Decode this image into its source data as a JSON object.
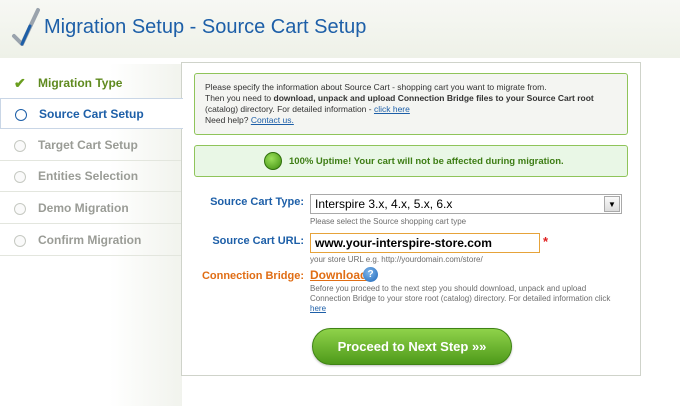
{
  "header": {
    "title": "Migration Setup - Source Cart Setup"
  },
  "sidebar": {
    "steps": [
      {
        "label": "Migration Type",
        "state": "done"
      },
      {
        "label": "Source Cart Setup",
        "state": "active"
      },
      {
        "label": "Target Cart Setup",
        "state": "pending"
      },
      {
        "label": "Entities Selection",
        "state": "pending"
      },
      {
        "label": "Demo Migration",
        "state": "pending"
      },
      {
        "label": "Confirm Migration",
        "state": "pending"
      }
    ]
  },
  "info": {
    "line1": "Please specify the information about Source Cart - shopping cart you want to migrate from.",
    "line2_prefix": "Then you need to ",
    "line2_bold": "download, unpack and upload Connection Bridge files to your Source Cart root",
    "line3": "(catalog) directory. For detailed information - ",
    "line3_link": "click here",
    "line4": "Need help? ",
    "line4_link": "Contact us."
  },
  "uptime": {
    "text": "100% Uptime! Your cart will not be affected during migration."
  },
  "form": {
    "source_type_label": "Source Cart Type:",
    "source_type_value": "Interspire 3.x, 4.x, 5.x, 6.x",
    "source_type_hint": "Please select the Source shopping cart type",
    "source_url_label": "Source Cart URL:",
    "source_url_value": "www.your-interspire-store.com",
    "source_url_hint": "your store URL e.g. http://yourdomain.com/store/",
    "required_mark": "*",
    "bridge_label": "Connection Bridge:",
    "bridge_download": "Download",
    "bridge_help": "?",
    "bridge_hint": "Before you proceed to the next step you should download, unpack and upload Connection Bridge to your store root (catalog) directory. For detailed information click ",
    "bridge_hint_link": "here"
  },
  "actions": {
    "proceed_label": "Proceed to Next Step »»"
  },
  "colors": {
    "accent_blue": "#1d5fa8",
    "accent_green": "#5fa82a",
    "accent_orange": "#e06d14"
  },
  "icons": {
    "select_arrow": "▼",
    "check": "✔"
  }
}
